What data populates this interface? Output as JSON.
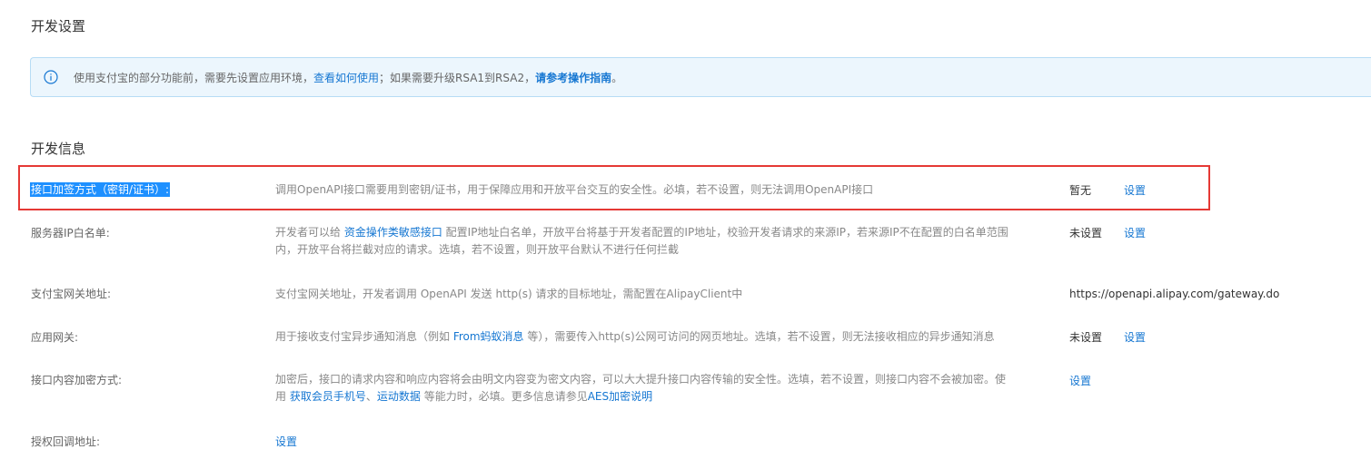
{
  "sections": {
    "dev_settings_title": "开发设置",
    "dev_info_title": "开发信息"
  },
  "notice": {
    "icon": "info-circle-icon",
    "text_before": "使用支付宝的部分功能前，需要先设置应用环境，",
    "link1": "查看如何使用",
    "text_middle": "；如果需要升级RSA1到RSA2，",
    "link2": "请参考操作指南",
    "text_end": "。"
  },
  "rows": {
    "signing": {
      "label": "接口加签方式（密钥/证书）:",
      "desc": "调用OpenAPI接口需要用到密钥/证书，用于保障应用和开放平台交互的安全性。必填，若不设置，则无法调用OpenAPI接口",
      "status": "暂无",
      "action": "设置"
    },
    "ip_whitelist": {
      "label": "服务器IP白名单:",
      "desc_before": "开发者可以给 ",
      "desc_link": "资金操作类敏感接口",
      "desc_after": " 配置IP地址白名单，开放平台将基于开发者配置的IP地址，校验开发者请求的来源IP，若来源IP不在配置的白名单范围内，开放平台将拦截对应的请求。选填，若不设置，则开放平台默认不进行任何拦截",
      "status": "未设置",
      "action": "设置"
    },
    "gateway": {
      "label": "支付宝网关地址:",
      "desc": "支付宝网关地址，开发者调用 OpenAPI 发送 http(s) 请求的目标地址，需配置在AlipayClient中",
      "value": "https://openapi.alipay.com/gateway.do"
    },
    "app_gateway": {
      "label": "应用网关:",
      "desc_before": "用于接收支付宝异步通知消息（例如 ",
      "desc_link": "From蚂蚁消息",
      "desc_after": " 等），需要传入http(s)公网可访问的网页地址。选填，若不设置，则无法接收相应的异步通知消息",
      "status": "未设置",
      "action": "设置"
    },
    "encryption": {
      "label": "接口内容加密方式:",
      "desc_before": "加密后，接口的请求内容和响应内容将会由明文内容变为密文内容，可以大大提升接口内容传输的安全性。选填，若不设置，则接口内容不会被加密。使用 ",
      "desc_link1": "获取会员手机号",
      "desc_sep": "、",
      "desc_link2": "运动数据",
      "desc_middle": " 等能力时，必填。更多信息请参见",
      "desc_link3": "AES加密说明",
      "action": "设置"
    },
    "auth_callback": {
      "label": "授权回调地址:",
      "action": "设置"
    }
  },
  "colors": {
    "link": "#1677d2",
    "highlight_border": "#e53935",
    "notice_bg": "#ecf6fd"
  }
}
